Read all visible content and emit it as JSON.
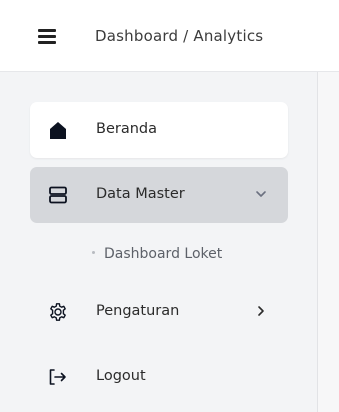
{
  "header": {
    "menu_icon": "hamburger-icon",
    "breadcrumb": "Dashboard / Analytics"
  },
  "sidebar": {
    "items": [
      {
        "label": "Beranda",
        "icon": "home-icon",
        "state": "active"
      },
      {
        "label": "Data Master",
        "icon": "server-icon",
        "state": "expanded",
        "chevron": "chevron-down-icon"
      },
      {
        "label": "Pengaturan",
        "icon": "gear-icon",
        "state": "collapsed",
        "chevron": "chevron-right-icon"
      },
      {
        "label": "Logout",
        "icon": "logout-icon"
      }
    ],
    "submenu": [
      {
        "label": "Dashboard Loket"
      }
    ]
  }
}
